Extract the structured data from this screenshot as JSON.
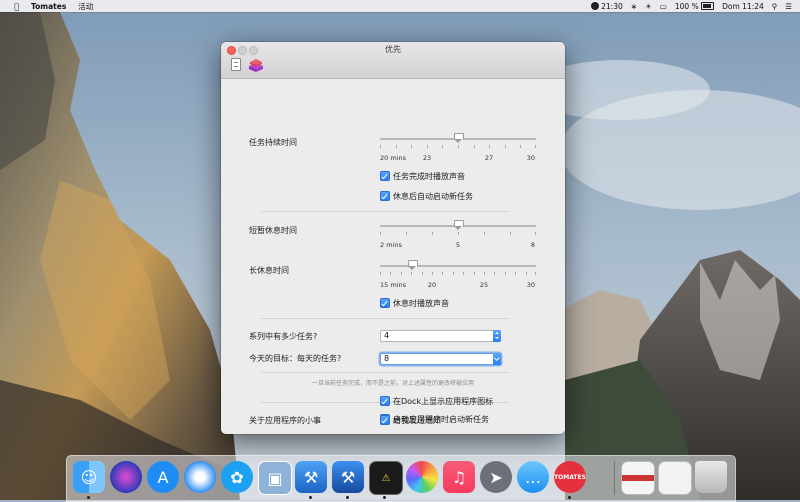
{
  "menubar": {
    "app_name": "Tomates",
    "menus": [
      "活动"
    ],
    "timer": "21:30",
    "battery": "100 %",
    "datetime": "Dom 11:24"
  },
  "window": {
    "title": "优先",
    "toolbar": [
      "general-tab",
      "tomato-tab"
    ]
  },
  "prefs": {
    "task_duration": {
      "label": "任务持续时间",
      "ticks": [
        "20 mins",
        "23",
        "27",
        "30"
      ],
      "value": 25,
      "min": 20,
      "max": 30
    },
    "sound_on_finish": "任务完成时播放声音",
    "auto_start_after_break": "休息后自动启动新任务",
    "short_break": {
      "label": "短暂休息时间",
      "ticks": [
        "2 mins",
        "5",
        "8"
      ],
      "value": 5,
      "min": 2,
      "max": 8
    },
    "long_break": {
      "label": "长休息时间",
      "ticks": [
        "15 mins",
        "20",
        "25",
        "30"
      ],
      "value": 18,
      "min": 15,
      "max": 30
    },
    "sound_on_break": "休息时播放声音",
    "series_count": {
      "label": "系列中有多少任务?",
      "value": "4"
    },
    "daily_goal": {
      "label": "今天的目标：每天的任务?",
      "value": "8"
    },
    "note": "一旦当前任务完成，而不是之前，对上述属性的更改将被应用",
    "app_section_label": "关于应用程序的小事",
    "start_on_launch": "启动应用程序时启动新任务",
    "show_dock_icon": "在Dock上显示应用程序图标",
    "send_notifications": "给我发送通知"
  },
  "dock": {
    "items": [
      "finder",
      "siri",
      "app-store",
      "safari",
      "twitter",
      "preview",
      "xcode",
      "xcode-beta",
      "console",
      "photos",
      "music",
      "launchpad",
      "messages",
      "tomatoes",
      "stack-1",
      "stack-2",
      "trash"
    ],
    "tomatoes_label": "TOMATES"
  },
  "colors": {
    "accent": "#2b7ef3",
    "close": "#fc615d"
  }
}
